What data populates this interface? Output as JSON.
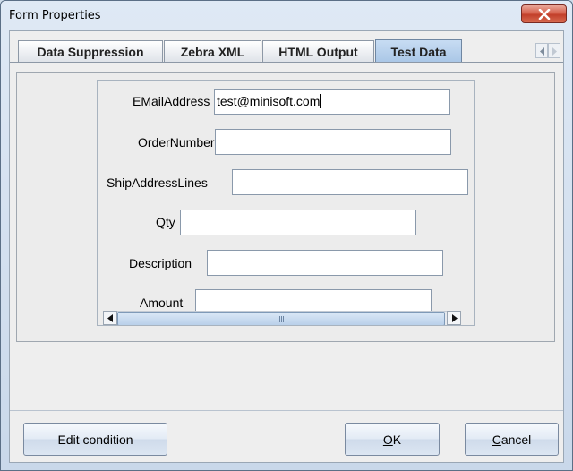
{
  "window": {
    "title": "Form Properties"
  },
  "tabs": [
    {
      "label": "Data Suppression",
      "active": false
    },
    {
      "label": "Zebra XML",
      "active": false
    },
    {
      "label": "HTML Output",
      "active": false
    },
    {
      "label": "Test Data",
      "active": true
    }
  ],
  "fields": [
    {
      "label": "EMailAddress",
      "value": "test@minisoft.com",
      "focused": true
    },
    {
      "label": "OrderNumber",
      "value": ""
    },
    {
      "label": "ShipAddressLines",
      "value": ""
    },
    {
      "label": "Qty",
      "value": ""
    },
    {
      "label": "Description",
      "value": ""
    },
    {
      "label": "Amount",
      "value": ""
    }
  ],
  "buttons": {
    "edit_condition": "Edit condition",
    "ok_mnemonic": "O",
    "ok_rest": "K",
    "cancel_mnemonic": "C",
    "cancel_rest": "ancel"
  },
  "icons": {
    "close": "close-x-icon",
    "tab_scroll_left": "triangle-left-icon",
    "tab_scroll_right": "triangle-right-icon",
    "scroll_up": "arrow-up-icon",
    "scroll_down": "arrow-down-icon",
    "scroll_left": "arrow-left-icon",
    "scroll_right": "arrow-right-icon"
  },
  "colors": {
    "active_tab": "#b6cfe9",
    "close_button": "#c94a36"
  }
}
